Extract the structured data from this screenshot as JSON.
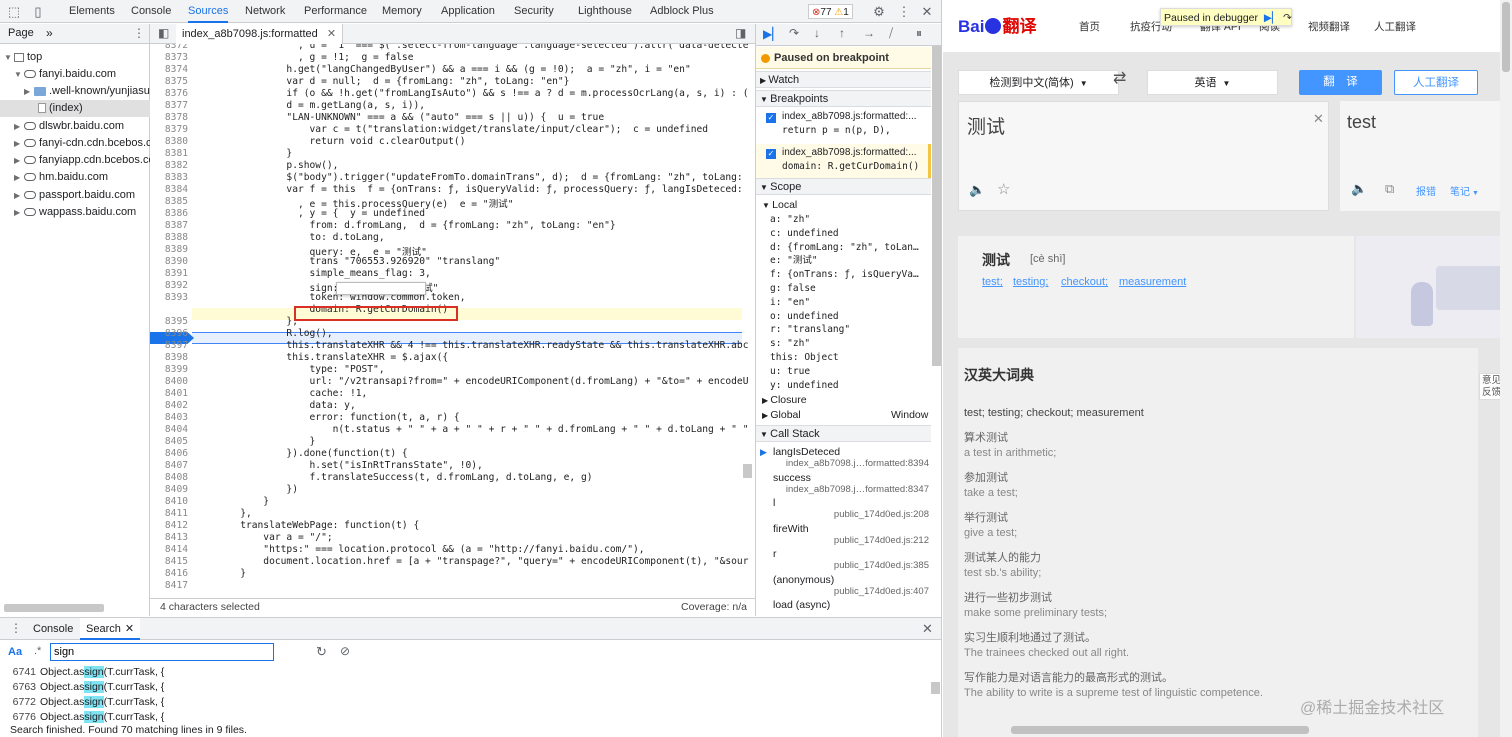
{
  "devtools": {
    "tabs": [
      "Elements",
      "Console",
      "Sources",
      "Network",
      "Performance",
      "Memory",
      "Application",
      "Security",
      "Lighthouse",
      "Adblock Plus"
    ],
    "active_tab": "Sources",
    "error_count": "77",
    "warning_count": "1",
    "nav": {
      "tab": "Page",
      "more": "»",
      "tree": [
        "top",
        "fanyi.baidu.com",
        ".well-known/yunjiasu",
        "(index)",
        "dlswbr.baidu.com",
        "fanyi-cdn.cdn.bcebos.com",
        "fanyiapp.cdn.bcebos.com",
        "hm.baidu.com",
        "passport.baidu.com",
        "wappass.baidu.com"
      ]
    },
    "editor": {
      "file_tab": "index_a8b7098.js:formatted",
      "status_left": "4 characters selected",
      "status_right": "Coverage: n/a",
      "lines": [
        {
          "n": "8372",
          "t": "                  , u = \"1\" === $(\".select-from-language .language-selected\").attr(\"data-detecte"
        },
        {
          "n": "8373",
          "t": "                  , g = !1;  g = false"
        },
        {
          "n": "8374",
          "t": "                h.get(\"langChangedByUser\") && a === i && (g = !0);  a = \"zh\", i = \"en\""
        },
        {
          "n": "8375",
          "t": "                var d = null;  d = {fromLang: \"zh\", toLang: \"en\"}"
        },
        {
          "n": "8376",
          "t": "                if (o && !h.get(\"fromLangIsAuto\") && s !== a ? d = m.processOcrLang(a, s, i) : ("
        },
        {
          "n": "8377",
          "t": "                d = m.getLang(a, s, i)),"
        },
        {
          "n": "8378",
          "t": "                \"LAN-UNKNOWN\" === a && (\"auto\" === s || u)) {  u = true"
        },
        {
          "n": "8379",
          "t": "                    var c = t(\"translation:widget/translate/input/clear\");  c = undefined"
        },
        {
          "n": "8380",
          "t": "                    return void c.clearOutput()"
        },
        {
          "n": "8381",
          "t": "                }"
        },
        {
          "n": "8382",
          "t": "                p.show(),"
        },
        {
          "n": "8383",
          "t": "                $(\"body\").trigger(\"updateFromTo.domainTrans\", d);  d = {fromLang: \"zh\", toLang:"
        },
        {
          "n": "8384",
          "t": "                var f = this  f = {onTrans: ƒ, isQueryValid: ƒ, processQuery: ƒ, langIsDeteced:"
        },
        {
          "n": "8385",
          "t": "                  , e = this.processQuery(e)  e = \"测试\""
        },
        {
          "n": "8386",
          "t": "                  , y = {  y = undefined"
        },
        {
          "n": "8387",
          "t": "                    from: d.fromLang,  d = {fromLang: \"zh\", toLang: \"en\"}"
        },
        {
          "n": "8388",
          "t": "                    to: d.toLang,"
        },
        {
          "n": "8389",
          "t": "                    query: e,  e = \"测试\""
        },
        {
          "n": "8390",
          "t": "                    trans \"706553.926920\" \"translang\""
        },
        {
          "n": "8391",
          "t": "                    simple_means_flag: 3,"
        },
        {
          "n": "8392",
          "t": "                    sign: L(e),  e = \"测试\""
        },
        {
          "n": "8393",
          "t": "                    token: window.common.token,"
        },
        {
          "n": "8394",
          "t": "                    domain: R.getCurDomain()"
        },
        {
          "n": "8395",
          "t": "                };"
        },
        {
          "n": "8396",
          "t": "                R.log(),"
        },
        {
          "n": "8397",
          "t": "                this.translateXHR && 4 !== this.translateXHR.readyState && this.translateXHR.abc"
        },
        {
          "n": "8398",
          "t": "                this.translateXHR = $.ajax({"
        },
        {
          "n": "8399",
          "t": "                    type: \"POST\","
        },
        {
          "n": "8400",
          "t": "                    url: \"/v2transapi?from=\" + encodeURIComponent(d.fromLang) + \"&to=\" + encodeU"
        },
        {
          "n": "8401",
          "t": "                    cache: !1,"
        },
        {
          "n": "8402",
          "t": "                    data: y,"
        },
        {
          "n": "8403",
          "t": "                    error: function(t, a, r) {"
        },
        {
          "n": "8404",
          "t": "                        n(t.status + \" \" + a + \" \" + r + \" \" + d.fromLang + \" \" + d.toLang + \" \""
        },
        {
          "n": "8405",
          "t": "                    }"
        },
        {
          "n": "8406",
          "t": "                }).done(function(t) {"
        },
        {
          "n": "8407",
          "t": "                    h.set(\"isInRtTransState\", !0),"
        },
        {
          "n": "8408",
          "t": "                    f.translateSuccess(t, d.fromLang, d.toLang, e, g)"
        },
        {
          "n": "8409",
          "t": "                })"
        },
        {
          "n": "8410",
          "t": "            }"
        },
        {
          "n": "8411",
          "t": "        },"
        },
        {
          "n": "8412",
          "t": "        translateWebPage: function(t) {"
        },
        {
          "n": "8413",
          "t": "            var a = \"/\";"
        },
        {
          "n": "8414",
          "t": "            \"https:\" === location.protocol && (a = \"http://fanyi.baidu.com/\"),"
        },
        {
          "n": "8415",
          "t": "            document.location.href = [a + \"transpage?\", \"query=\" + encodeURIComponent(t), \"&sour"
        },
        {
          "n": "8416",
          "t": "        }"
        },
        {
          "n": "8417",
          "t": ""
        }
      ]
    },
    "debugger": {
      "paused": "Paused on breakpoint",
      "watch": "Watch",
      "breakpoints": "Breakpoints",
      "bp": [
        {
          "file": "index_a8b7098.js:formatted:...",
          "code": "return p = n(p, D),"
        },
        {
          "file": "index_a8b7098.js:formatted:...",
          "code": "domain: R.getCurDomain()"
        }
      ],
      "scope": "Scope",
      "local": "Local",
      "vars": [
        "a: \"zh\"",
        "c: undefined",
        "d: {fromLang: \"zh\", toLan…",
        "e: \"测试\"",
        "f: {onTrans: ƒ, isQueryVa…",
        "g: false",
        "i: \"en\"",
        "o: undefined",
        "r: \"translang\"",
        "s: \"zh\"",
        "this: Object",
        "u: true",
        "y: undefined"
      ],
      "closure": "Closure",
      "global": "Global",
      "global_val": "Window",
      "callstack": "Call Stack",
      "frames": [
        {
          "name": "langIsDeteced",
          "loc": "index_a8b7098.j…formatted:8394"
        },
        {
          "name": "success",
          "loc": "index_a8b7098.j…formatted:8347"
        },
        {
          "name": "l",
          "loc": "public_174d0ed.js:208"
        },
        {
          "name": "fireWith",
          "loc": "public_174d0ed.js:212"
        },
        {
          "name": "r",
          "loc": "public_174d0ed.js:385"
        },
        {
          "name": "(anonymous)",
          "loc": "public_174d0ed.js:407"
        },
        {
          "name": "load (async)",
          "loc": ""
        }
      ]
    },
    "drawer": {
      "tabs": [
        "Console",
        "Search"
      ],
      "search_value": "sign",
      "case_btn": "Aa",
      "regex_btn": ".*",
      "results": [
        {
          "n": "6741",
          "pre": "Object.as",
          "hit": "sign",
          "post": "(T.currTask, {"
        },
        {
          "n": "6763",
          "pre": "Object.as",
          "hit": "sign",
          "post": "(T.currTask, {"
        },
        {
          "n": "6772",
          "pre": "Object.as",
          "hit": "sign",
          "post": "(T.currTask, {"
        },
        {
          "n": "6776",
          "pre": "Object.as",
          "hit": "sign",
          "post": "(T.currTask, {"
        }
      ],
      "status": "Search finished.  Found 70 matching lines in 9 files."
    }
  },
  "page": {
    "logo_text": "Bai",
    "logo_tail": "翻译",
    "nav": [
      "首页",
      "抗疫行动",
      "翻译 API",
      "阅读",
      "视频翻译",
      "人工翻译"
    ],
    "paused_label": "Paused in debugger",
    "from_lang": "检测到中文(简体)",
    "to_lang": "英语",
    "translate_btn": "翻　译",
    "human_btn": "人工翻译",
    "source_text": "测试",
    "target_text": "test",
    "report": "报错",
    "note": "笔记",
    "headword": "测试",
    "pinyin": "[cè shì]",
    "links": [
      "test;",
      "testing;",
      "checkout;",
      "measurement"
    ],
    "dict_title": "汉英大词典",
    "dict_summary": "test; testing; checkout; measurement",
    "entries": [
      {
        "cn": "算术测试",
        "en": "a test in arithmetic;"
      },
      {
        "cn": "参加测试",
        "en": "take a test;"
      },
      {
        "cn": "举行测试",
        "en": "give a test;"
      },
      {
        "cn": "测试某人的能力",
        "en": "test sb.'s ability;"
      },
      {
        "cn": "进行一些初步测试",
        "en": "make some preliminary tests;"
      },
      {
        "cn": "实习生顺利地通过了测试。",
        "en": "The trainees checked out all right."
      },
      {
        "cn": "写作能力是对语言能力的最高形式的测试。",
        "en": "The ability to write is a supreme test of linguistic competence."
      }
    ],
    "feedback": "意见反馈",
    "watermark": "@稀土掘金技术社区"
  }
}
